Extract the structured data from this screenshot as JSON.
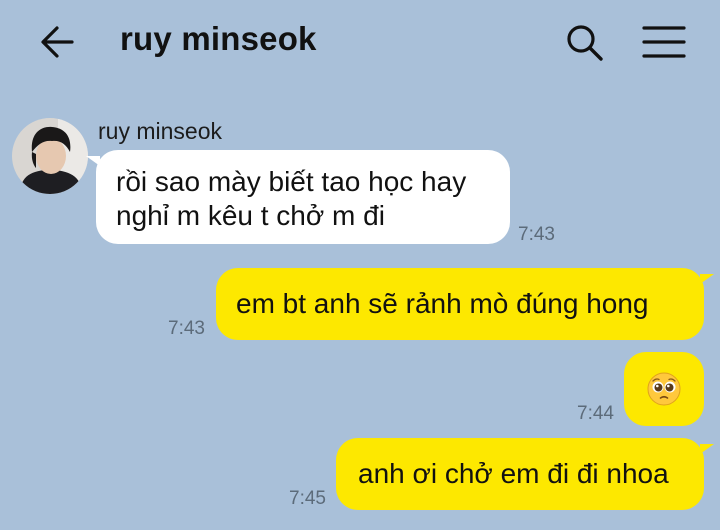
{
  "header": {
    "title": "ruy minseok",
    "back_icon": "arrow-left-icon",
    "search_icon": "search-icon",
    "menu_icon": "hamburger-menu-icon"
  },
  "colors": {
    "background": "#a9c0d9",
    "incoming_bubble": "#ffffff",
    "outgoing_bubble": "#fde800",
    "timestamp": "#5c6b7a"
  },
  "messages": [
    {
      "direction": "incoming",
      "sender": "ruy minseok",
      "lines": [
        "rồi sao mày biết tao học hay",
        "nghỉ m kêu t chở m đi"
      ],
      "time": "7:43"
    },
    {
      "direction": "outgoing",
      "text": "em bt anh sẽ rảnh mò đúng hong",
      "time": "7:43"
    },
    {
      "direction": "outgoing",
      "emoji": "pleading-face-icon",
      "time": "7:44"
    },
    {
      "direction": "outgoing",
      "text": "anh ơi chở em đi đi nhoa",
      "time": "7:45"
    }
  ]
}
